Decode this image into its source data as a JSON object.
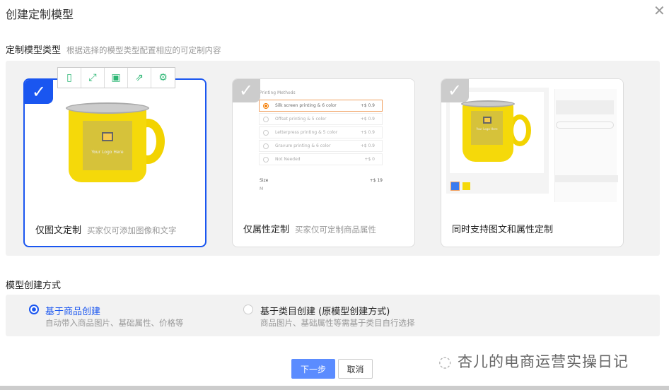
{
  "dialog": {
    "title": "创建定制模型",
    "close_icon": "close-icon"
  },
  "model_type": {
    "label": "定制模型类型",
    "hint": "根据选择的模型类型配置相应的可定制内容",
    "cards": [
      {
        "title": "仅图文定制",
        "desc": "买家仅可添加图像和文字",
        "selected": true,
        "logo_text": "Your Logo Here"
      },
      {
        "title": "仅属性定制",
        "desc": "买家仅可定制商品属性",
        "selected": false,
        "preview": {
          "heading": "Printing Methods",
          "options": [
            {
              "label": "Silk screen printing & 6 color",
              "price": "+$ 0.9",
              "selected": true
            },
            {
              "label": "Offset printing & 5 color",
              "price": "+$ 0.9"
            },
            {
              "label": "Letterpress printing & 5 color",
              "price": "+$ 0.9"
            },
            {
              "label": "Gravure  printing & 6 color",
              "price": "+$ 0.9"
            },
            {
              "label": "Not Needed",
              "price": "+$ 0"
            }
          ],
          "size_label": "Size",
          "size_price": "+$ 19",
          "size_value": "M"
        }
      },
      {
        "title": "同时支持图文和属性定制",
        "desc": "",
        "selected": false,
        "logo_text": "Your Logo Here"
      }
    ],
    "toolbar": [
      "tablet-icon",
      "expand-icon",
      "save-icon",
      "share-icon",
      "settings-icon"
    ]
  },
  "creation": {
    "label": "模型创建方式",
    "options": [
      {
        "title": "基于商品创建",
        "desc": "自动带入商品图片、基础属性、价格等",
        "selected": true
      },
      {
        "title": "基于类目创建 (原模型创建方式)",
        "desc": "商品图片、基础属性等需基于类目自行选择",
        "selected": false
      }
    ]
  },
  "buttons": {
    "next": "下一步",
    "cancel": "取消"
  },
  "watermark": "杏儿的电商运营实操日记",
  "colors": {
    "primary": "#1a56f0",
    "button": "#5b8cff",
    "tool": "#2bb673"
  }
}
